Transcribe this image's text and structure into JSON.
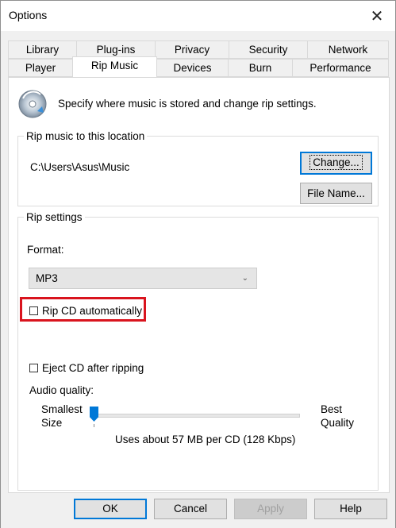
{
  "window": {
    "title": "Options",
    "close_symbol": "✕"
  },
  "tabs": {
    "row1": [
      "Library",
      "Plug-ins",
      "Privacy",
      "Security",
      "Network"
    ],
    "row2": [
      "Player",
      "Rip Music",
      "Devices",
      "Burn",
      "Performance"
    ],
    "active": "Rip Music"
  },
  "header": {
    "text": "Specify where music is stored and change rip settings.",
    "icon": "cd-rip-icon"
  },
  "location_group": {
    "legend": "Rip music to this location",
    "path": "C:\\Users\\Asus\\Music",
    "change_button": "Change...",
    "filename_button": "File Name..."
  },
  "rip_settings": {
    "legend": "Rip settings",
    "format_label": "Format:",
    "format_value": "MP3",
    "rip_cd_auto_label": "Rip CD automatically",
    "rip_cd_auto_checked": false,
    "eject_label": "Eject CD after ripping",
    "eject_checked": false,
    "audio_quality_label": "Audio quality:",
    "slider_left_label_1": "Smallest",
    "slider_left_label_2": "Size",
    "slider_right_label_1": "Best",
    "slider_right_label_2": "Quality",
    "slider_position": 0,
    "usage_text": "Uses about 57 MB per CD (128 Kbps)"
  },
  "buttons": {
    "ok": "OK",
    "cancel": "Cancel",
    "apply": "Apply",
    "help": "Help"
  },
  "colors": {
    "highlight": "#d9141e",
    "accent": "#0078d7"
  }
}
